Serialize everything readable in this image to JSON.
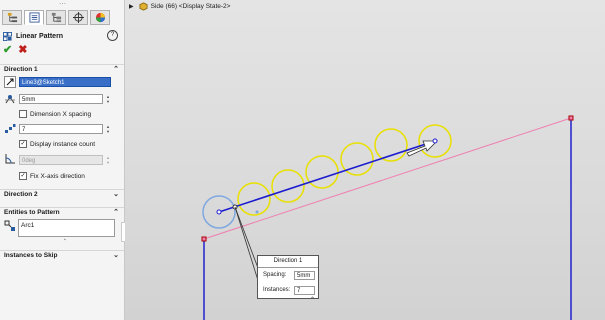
{
  "panel": {
    "tabs": [
      "feature-manager",
      "property-manager",
      "configuration-manager",
      "dimxpert-manager",
      "display-manager"
    ],
    "title": "Linear Pattern",
    "help": "?",
    "ok": "✔",
    "cancel": "✖",
    "direction1": {
      "header": "Direction 1",
      "direction_ref": "Line3@Sketch1",
      "spacing": "5mm",
      "dimension_x_spacing_label": "Dimension X spacing",
      "dimension_x_spacing_checked": false,
      "instances": "7",
      "display_instance_count_label": "Display instance count",
      "display_instance_count_checked": true,
      "angle": "0deg",
      "fix_x_axis_label": "Fix X-axis direction",
      "fix_x_axis_checked": true
    },
    "direction2": {
      "header": "Direction 2"
    },
    "entities": {
      "header": "Entities to Pattern",
      "items": [
        "Arc1"
      ]
    },
    "instances_to_skip": {
      "header": "Instances to Skip"
    }
  },
  "canvas": {
    "breadcrumb": "Side (66) <Display State-2>",
    "popup": {
      "title": "Direction 1",
      "spacing_label": "Spacing:",
      "spacing_value": "5mm",
      "instances_label": "Instances:",
      "instances_value": "7"
    },
    "colors": {
      "pattern_line": "#1c1ccf",
      "instance_circle": "#e8e000",
      "seed_circle": "#7fa8e0",
      "construction": "#ef7fb0",
      "frame": "#2222cc"
    }
  }
}
